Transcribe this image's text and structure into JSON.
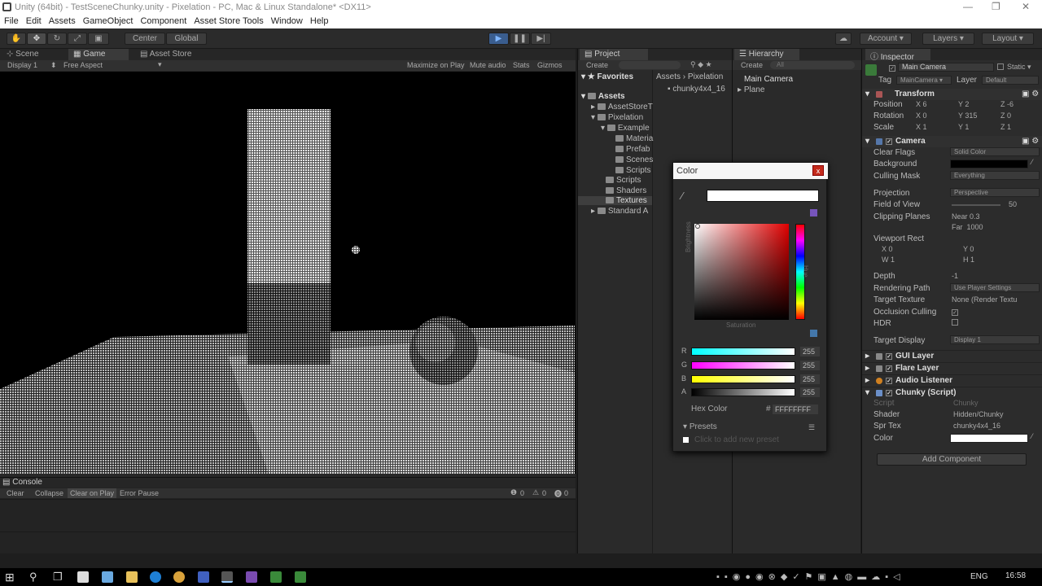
{
  "window": {
    "title": "Unity (64bit) - TestSceneChunky.unity - Pixelation - PC, Mac & Linux Standalone* <DX11>"
  },
  "menu": [
    "File",
    "Edit",
    "Assets",
    "GameObject",
    "Component",
    "Asset Store Tools",
    "Window",
    "Help"
  ],
  "toolbar": {
    "pivot": "Center",
    "space": "Global",
    "account": "Account",
    "layers": "Layers",
    "layout": "Layout"
  },
  "scene_tabs": {
    "scene": "Scene",
    "game": "Game",
    "store": "Asset Store"
  },
  "game_bar": {
    "display": "Display 1",
    "aspect": "Free Aspect",
    "maximize": "Maximize on Play",
    "mute": "Mute audio",
    "stats": "Stats",
    "gizmos": "Gizmos"
  },
  "console": {
    "title": "Console",
    "clear": "Clear",
    "collapse": "Collapse",
    "clear_on_play": "Clear on Play",
    "error_pause": "Error Pause",
    "count_info": "0",
    "count_warn": "0",
    "count_err": "0"
  },
  "project": {
    "title": "Project",
    "create": "Create",
    "favorites": "Favorites",
    "breadcrumb_assets": "Assets",
    "breadcrumb_sep": "›",
    "breadcrumb_pix": "Pixelation",
    "selected_asset": "chunky4x4_16",
    "tree": {
      "assets": "Assets",
      "asset_store": "AssetStoreT",
      "pixelation": "Pixelation",
      "example": "Example",
      "materials": "Materia",
      "prefabs": "Prefab",
      "scenes": "Scenes",
      "ex_scripts": "Scripts",
      "scripts": "Scripts",
      "shaders": "Shaders",
      "textures": "Textures",
      "standard": "Standard A"
    }
  },
  "hierarchy": {
    "title": "Hierarchy",
    "create": "Create",
    "search": "All",
    "items": [
      "Main Camera",
      "Plane"
    ]
  },
  "inspector": {
    "title": "Inspector",
    "object_name": "Main Camera",
    "static": "Static",
    "tag_label": "Tag",
    "tag": "MainCamera",
    "layer_label": "Layer",
    "layer": "Default",
    "transform": {
      "title": "Transform",
      "position": "Position",
      "px": "6",
      "py": "2",
      "pz": "-6",
      "rotation": "Rotation",
      "rx": "0",
      "ry": "315",
      "rz": "0",
      "scale": "Scale",
      "sx": "1",
      "sy": "1",
      "sz": "1"
    },
    "camera": {
      "title": "Camera",
      "clear_flags": "Clear Flags",
      "clear_flags_val": "Solid Color",
      "background": "Background",
      "culling_mask": "Culling Mask",
      "culling_mask_val": "Everything",
      "projection": "Projection",
      "projection_val": "Perspective",
      "fov": "Field of View",
      "fov_val": "50",
      "clipping": "Clipping Planes",
      "near": "Near",
      "near_val": "0.3",
      "far": "Far",
      "far_val": "1000",
      "viewport": "Viewport Rect",
      "vx": "0",
      "vy": "0",
      "vw": "1",
      "vh": "1",
      "depth": "Depth",
      "depth_val": "-1",
      "render_path": "Rendering Path",
      "render_path_val": "Use Player Settings",
      "target_tex": "Target Texture",
      "target_tex_val": "None (Render Textu",
      "occlusion": "Occlusion Culling",
      "hdr": "HDR",
      "target_display": "Target Display",
      "target_display_val": "Display 1"
    },
    "gui_layer": "GUI Layer",
    "flare_layer": "Flare Layer",
    "audio_listener": "Audio Listener",
    "chunky": {
      "title": "Chunky (Script)",
      "script": "Script",
      "script_val": "Chunky",
      "shader": "Shader",
      "shader_val": "Hidden/Chunky",
      "spr_tex": "Spr Tex",
      "spr_tex_val": "chunky4x4_16",
      "color": "Color"
    },
    "add_component": "Add Component"
  },
  "color_picker": {
    "title": "Color",
    "brightness": "Brightness",
    "saturation": "Saturation",
    "hue": "Hue",
    "r_label": "R",
    "r": "255",
    "g_label": "G",
    "g": "255",
    "b_label": "B",
    "b": "255",
    "a_label": "A",
    "a": "255",
    "hex_label": "Hex Color",
    "hex": "FFFFFFFF",
    "presets": "Presets",
    "add_preset": "Click to add new preset"
  },
  "taskbar": {
    "lang": "ENG",
    "time": "16:58"
  }
}
